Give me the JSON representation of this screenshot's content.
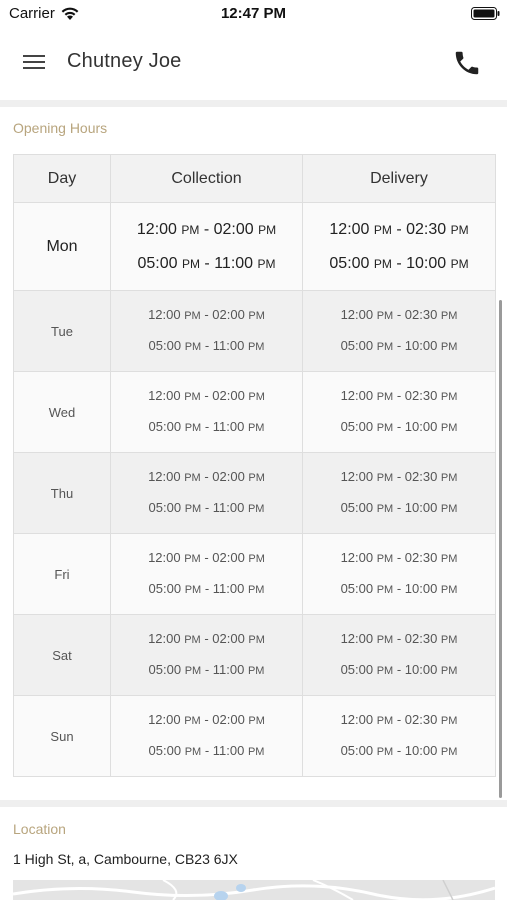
{
  "status_bar": {
    "carrier": "Carrier",
    "time": "12:47 PM"
  },
  "header": {
    "title": "Chutney Joe",
    "menu_icon": "hamburger-menu-icon",
    "phone_icon": "phone-icon"
  },
  "opening_hours": {
    "section_title": "Opening Hours",
    "columns": [
      "Day",
      "Collection",
      "Delivery"
    ],
    "rows": [
      {
        "day": "Mon",
        "collection": [
          "12:00 PM - 02:00 PM",
          "05:00 PM - 11:00 PM"
        ],
        "delivery": [
          "12:00 PM - 02:30 PM",
          "05:00 PM - 10:00 PM"
        ]
      },
      {
        "day": "Tue",
        "collection": [
          "12:00 PM - 02:00 PM",
          "05:00 PM - 11:00 PM"
        ],
        "delivery": [
          "12:00 PM - 02:30 PM",
          "05:00 PM - 10:00 PM"
        ]
      },
      {
        "day": "Wed",
        "collection": [
          "12:00 PM - 02:00 PM",
          "05:00 PM - 11:00 PM"
        ],
        "delivery": [
          "12:00 PM - 02:30 PM",
          "05:00 PM - 10:00 PM"
        ]
      },
      {
        "day": "Thu",
        "collection": [
          "12:00 PM - 02:00 PM",
          "05:00 PM - 11:00 PM"
        ],
        "delivery": [
          "12:00 PM - 02:30 PM",
          "05:00 PM - 10:00 PM"
        ]
      },
      {
        "day": "Fri",
        "collection": [
          "12:00 PM - 02:00 PM",
          "05:00 PM - 11:00 PM"
        ],
        "delivery": [
          "12:00 PM - 02:30 PM",
          "05:00 PM - 10:00 PM"
        ]
      },
      {
        "day": "Sat",
        "collection": [
          "12:00 PM - 02:00 PM",
          "05:00 PM - 11:00 PM"
        ],
        "delivery": [
          "12:00 PM - 02:30 PM",
          "05:00 PM - 10:00 PM"
        ]
      },
      {
        "day": "Sun",
        "collection": [
          "12:00 PM - 02:00 PM",
          "05:00 PM - 11:00 PM"
        ],
        "delivery": [
          "12:00 PM - 02:30 PM",
          "05:00 PM - 10:00 PM"
        ]
      }
    ]
  },
  "location": {
    "section_title": "Location",
    "address": "1 High St, a, Cambourne, CB23 6JX"
  },
  "colors": {
    "accent": "#b8a57e",
    "divider": "#efefef",
    "table_border": "#dedede"
  }
}
